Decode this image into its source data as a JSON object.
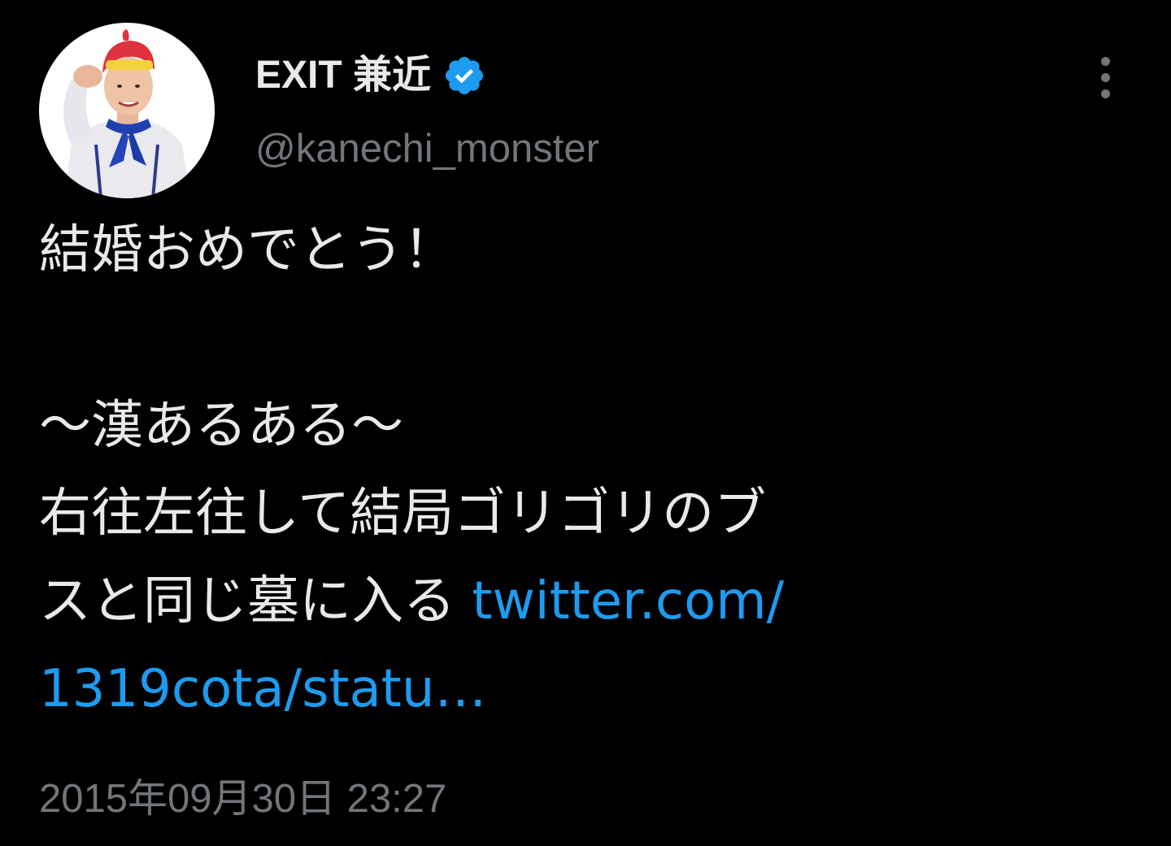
{
  "author": {
    "display_name": "EXIT 兼近",
    "handle": "@kanechi_monster",
    "verified": true,
    "verified_color": "#1d9bf0"
  },
  "more_icon": "more-vertical-icon",
  "tweet": {
    "line1": "結婚おめでとう！",
    "line2": "",
    "line3": "〜漢あるある〜",
    "line4": "右往左往して結局ゴリゴリのブ",
    "line5_text": "スと同じ墓に入る ",
    "line5_link": "twitter.com/",
    "line6_link": "1319cota/statu…",
    "link_color": "#1d9bf0"
  },
  "timestamp": "2015年09月30日 23:27",
  "colors": {
    "background": "#000000",
    "primary_text": "#e7e9ea",
    "secondary_text": "#71767b"
  }
}
